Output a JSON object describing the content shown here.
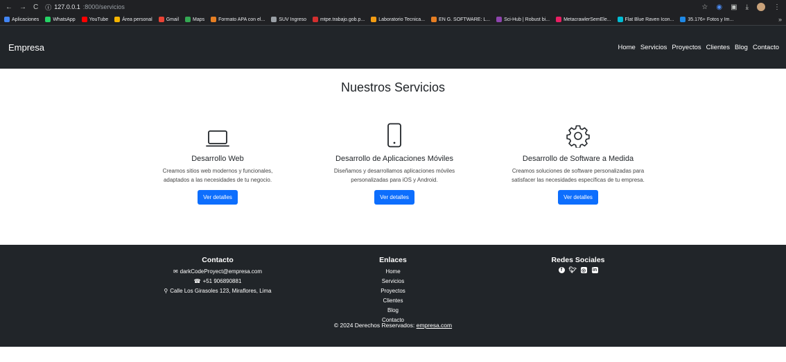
{
  "browser": {
    "url_host": "127.0.0.1",
    "url_path": ":8000/servicios",
    "bookmarks": [
      {
        "label": "Aplicaciones",
        "color": "#4285f4"
      },
      {
        "label": "WhatsApp",
        "color": "#25d366"
      },
      {
        "label": "YouTube",
        "color": "#ff0000"
      },
      {
        "label": "Área personal",
        "color": "#f4b400"
      },
      {
        "label": "Gmail",
        "color": "#ea4335"
      },
      {
        "label": "Maps",
        "color": "#34a853"
      },
      {
        "label": "Formato APA con el...",
        "color": "#e67e22"
      },
      {
        "label": "SUV Ingreso",
        "color": "#9aa0a6"
      },
      {
        "label": "mtpe.trabajo.gob.p...",
        "color": "#d32f2f"
      },
      {
        "label": "Laboratorio Tecnica...",
        "color": "#f39c12"
      },
      {
        "label": "EN G. SOFTWARE: L...",
        "color": "#e67e22"
      },
      {
        "label": "Sci-Hub | Robust bi...",
        "color": "#8e44ad"
      },
      {
        "label": "MetacrawlerSemEle...",
        "color": "#e91e63"
      },
      {
        "label": "Flat Blue Raven Icon...",
        "color": "#00bcd4"
      },
      {
        "label": "35.176+ Fotos y Im...",
        "color": "#1e88e5"
      }
    ]
  },
  "navbar": {
    "brand": "Empresa",
    "links": [
      "Home",
      "Servicios",
      "Proyectos",
      "Clientes",
      "Blog",
      "Contacto"
    ]
  },
  "main": {
    "title": "Nuestros Servicios",
    "services": [
      {
        "icon": "laptop-icon",
        "title": "Desarrollo Web",
        "line1": "Creamos sitios web modernos y funcionales,",
        "line2": "adaptados a las necesidades de tu negocio.",
        "button": "Ver detalles"
      },
      {
        "icon": "phone-icon",
        "title": "Desarrollo de Aplicaciones Móviles",
        "line1": "Diseñamos y desarrollamos aplicaciones móviles",
        "line2": "personalizadas para iOS y Android.",
        "button": "Ver detalles"
      },
      {
        "icon": "gear-icon",
        "title": "Desarrollo de Software a Medida",
        "line1": "Creamos soluciones de software personalizadas para",
        "line2": "satisfacer las necesidades específicas de tu empresa.",
        "button": "Ver detalles"
      }
    ]
  },
  "footer": {
    "contact": {
      "title": "Contacto",
      "email": "darkCodeProyect@empresa.com",
      "phone": "+51 906890881",
      "address": "Calle Los Girasoles 123, Miraflores, Lima"
    },
    "links": {
      "title": "Enlaces",
      "items": [
        "Home",
        "Servicios",
        "Proyectos",
        "Clientes",
        "Blog",
        "Contacto"
      ]
    },
    "social": {
      "title": "Redes Sociales",
      "icons": [
        "facebook-icon",
        "twitter-icon",
        "instagram-icon",
        "linkedin-icon"
      ]
    },
    "copyright_prefix": "© 2024 Derechos Reservados: ",
    "copyright_link": "empresa.com"
  },
  "colors": {
    "dark": "#212529",
    "primary": "#0d6efd"
  }
}
